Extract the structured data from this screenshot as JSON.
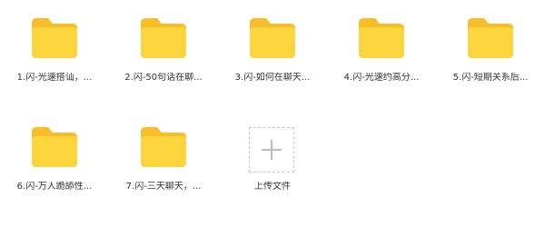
{
  "colors": {
    "folder_back": "#F5BE2A",
    "folder_front": "#FCD43C",
    "label_text": "#333333",
    "dashed_border": "#C8C8C8",
    "plus": "#BDBDBD"
  },
  "folders": [
    {
      "label": "1.闪-光速搭讪，...",
      "icon": "folder-icon"
    },
    {
      "label": "2.闪-50句话在聊...",
      "icon": "folder-icon"
    },
    {
      "label": "3.闪-如何在聊天...",
      "icon": "folder-icon"
    },
    {
      "label": "4.闪-光速约高分...",
      "icon": "folder-icon"
    },
    {
      "label": "5.闪-短期关系后...",
      "icon": "folder-icon"
    },
    {
      "label": "6.闪-万人跪舔性...",
      "icon": "folder-icon"
    },
    {
      "label": "7.闪-三天聊天，...",
      "icon": "folder-icon"
    }
  ],
  "upload": {
    "label": "上传文件",
    "icon": "plus-icon"
  }
}
